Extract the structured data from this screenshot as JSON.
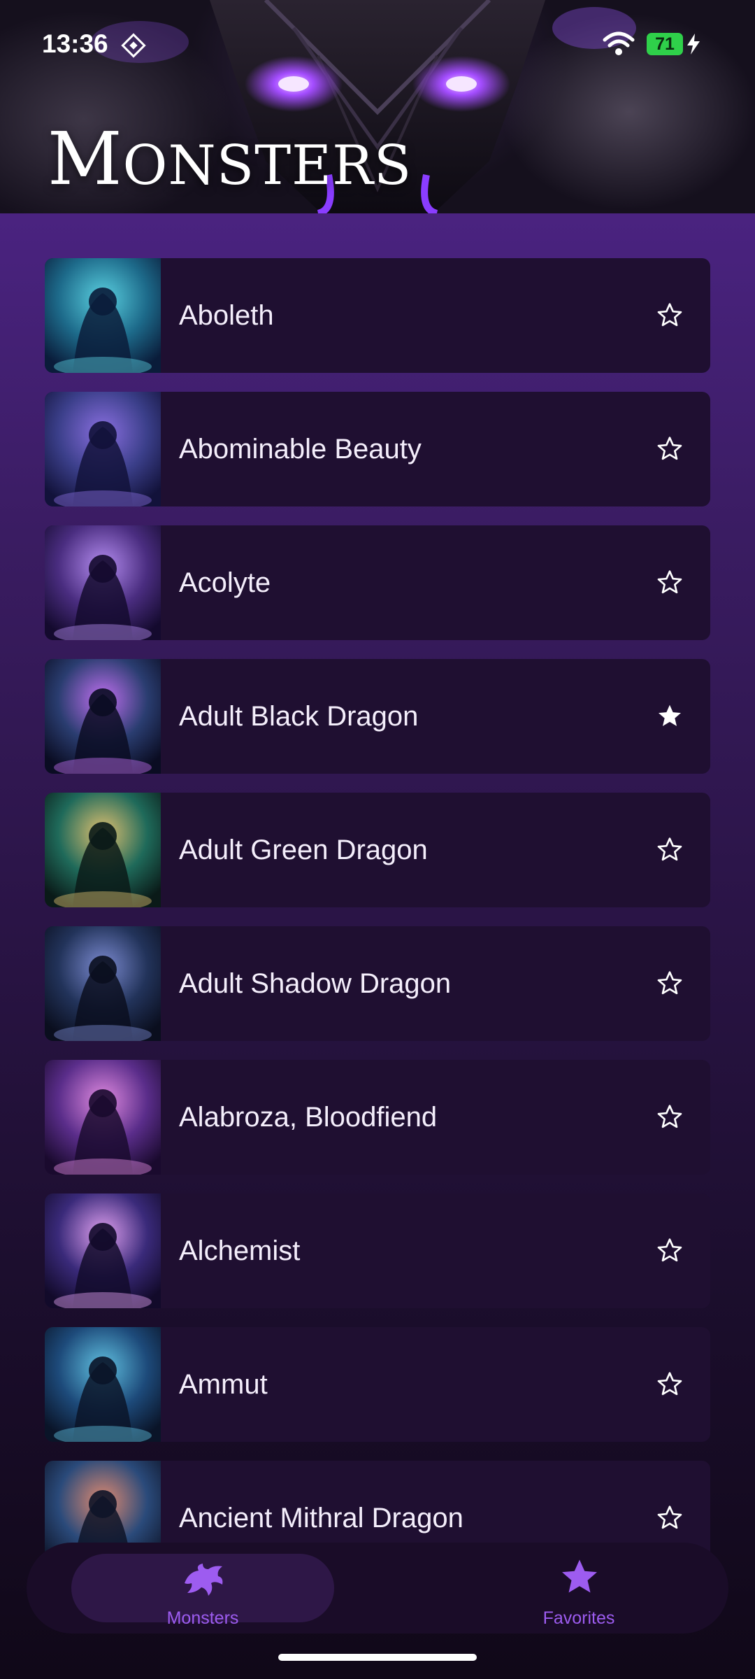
{
  "status_bar": {
    "time": "13:36",
    "battery": "71",
    "icons": [
      "gps-diamond-icon",
      "wifi-icon",
      "charging-bolt-icon"
    ]
  },
  "header": {
    "title_first": "M",
    "title_rest": "ONSTERS"
  },
  "monsters": [
    {
      "name": "Aboleth",
      "favorite": false,
      "thumb": [
        "#1d6a8a",
        "#5ad0e0",
        "#0a1c3a"
      ]
    },
    {
      "name": "Abominable Beauty",
      "favorite": false,
      "thumb": [
        "#3b3f8a",
        "#8a6fe0",
        "#12123a"
      ]
    },
    {
      "name": "Acolyte",
      "favorite": false,
      "thumb": [
        "#4a2d80",
        "#b48cf0",
        "#140a2e"
      ]
    },
    {
      "name": "Adult Black Dragon",
      "favorite": true,
      "thumb": [
        "#2a3d70",
        "#c06ff0",
        "#0a0c22"
      ]
    },
    {
      "name": "Adult Green Dragon",
      "favorite": false,
      "thumb": [
        "#1f6a5a",
        "#e0c070",
        "#0a1a18"
      ]
    },
    {
      "name": "Adult Shadow Dragon",
      "favorite": false,
      "thumb": [
        "#22335a",
        "#7b8ad0",
        "#0a0e1e"
      ]
    },
    {
      "name": "Alabroza, Bloodfiend",
      "favorite": false,
      "thumb": [
        "#5a2d8a",
        "#e08ae0",
        "#1a0a2e"
      ]
    },
    {
      "name": "Alchemist",
      "favorite": false,
      "thumb": [
        "#3a2a7a",
        "#e0a0f0",
        "#120a2a"
      ]
    },
    {
      "name": "Ammut",
      "favorite": false,
      "thumb": [
        "#1d4a7a",
        "#60c0e0",
        "#0a1428"
      ]
    },
    {
      "name": "Ancient Mithral Dragon",
      "favorite": false,
      "thumb": [
        "#2a4a7a",
        "#e08a70",
        "#0e1428"
      ]
    }
  ],
  "nav": {
    "monsters_label": "Monsters",
    "favorites_label": "Favorites",
    "active": "monsters"
  },
  "colors": {
    "accent": "#9d5cf0",
    "card_bg": "#1f0f31",
    "star": "#ffffff"
  }
}
